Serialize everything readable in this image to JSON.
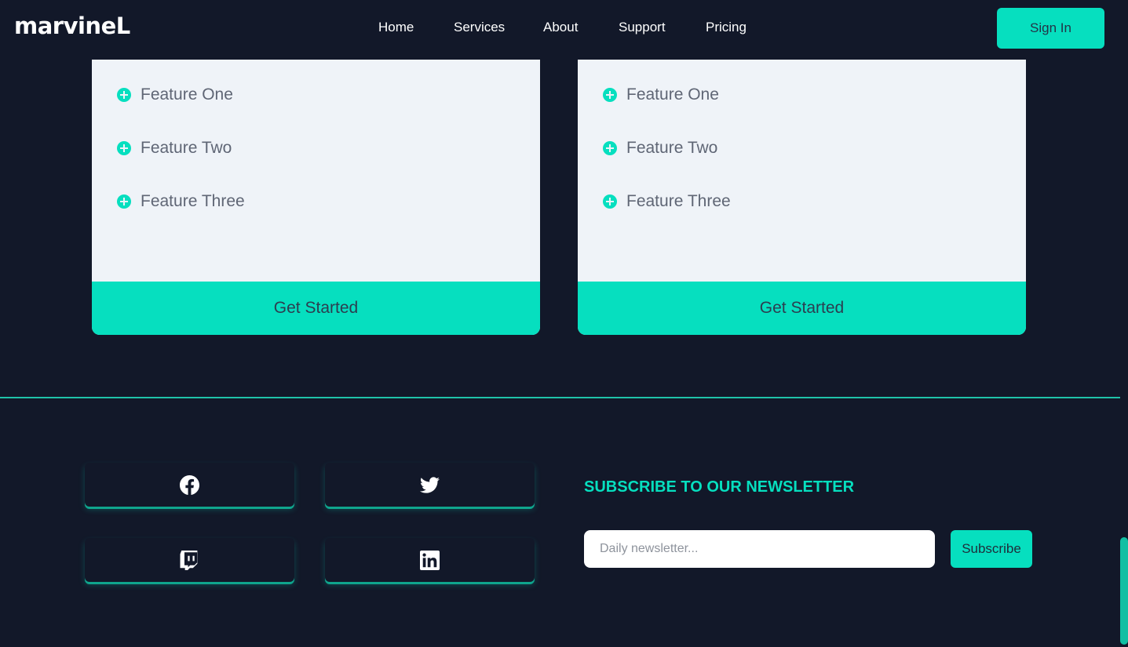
{
  "brand": {
    "logo_text": "marvineL",
    "accent_color": "#06dfbf",
    "background_color": "#121829"
  },
  "nav": {
    "items": [
      {
        "label": "Home"
      },
      {
        "label": "Services"
      },
      {
        "label": "About"
      },
      {
        "label": "Support"
      },
      {
        "label": "Pricing"
      }
    ],
    "signin_label": "Sign In"
  },
  "pricing": {
    "cards": [
      {
        "features": [
          "Feature One",
          "Feature Two",
          "Feature Three"
        ],
        "cta_label": "Get Started"
      },
      {
        "features": [
          "Feature One",
          "Feature Two",
          "Feature Three"
        ],
        "cta_label": "Get Started"
      }
    ]
  },
  "footer": {
    "social": [
      {
        "icon": "facebook-icon"
      },
      {
        "icon": "twitter-icon"
      },
      {
        "icon": "twitch-icon"
      },
      {
        "icon": "linkedin-icon"
      }
    ],
    "newsletter": {
      "title": "SUBSCRIBE TO OUR NEWSLETTER",
      "input_placeholder": "Daily newsletter...",
      "input_value": "",
      "subscribe_label": "Subscribe"
    }
  }
}
